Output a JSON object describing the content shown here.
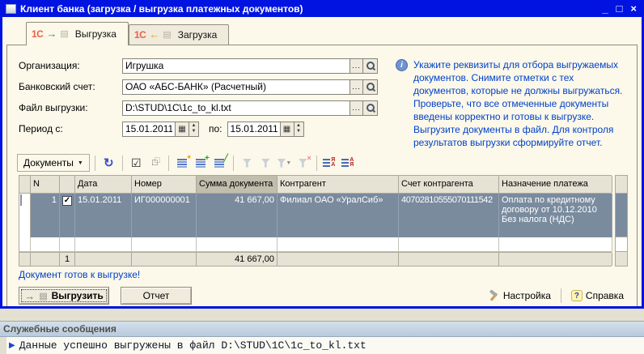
{
  "window": {
    "title": "Клиент банка (загрузка / выгрузка платежных документов)",
    "minimize_glyph": "_",
    "maximize_glyph": "□",
    "close_glyph": "×"
  },
  "tabs": {
    "logo": "1С",
    "export": {
      "label": "Выгрузка",
      "arrow": "→"
    },
    "import": {
      "label": "Загрузка",
      "arrow": "←"
    }
  },
  "form": {
    "organization": {
      "label": "Организация:",
      "value": "Игрушка"
    },
    "bank_account": {
      "label": "Банковский счет:",
      "value": "ОАО «АБС-БАНК» (Расчетный)"
    },
    "export_file": {
      "label": "Файл выгрузки:",
      "value": "D:\\STUD\\1C\\1c_to_kl.txt"
    },
    "period": {
      "label": "Период с:",
      "from": "15.01.2011",
      "to_label": "по:",
      "to": "15.01.2011"
    }
  },
  "info_panel": {
    "icon_glyph": "i",
    "lines": [
      "Укажите реквизиты для отбора выгружаемых документов. Снимите отметки с тех документов, которые не должны выгружаться.",
      "Проверьте, что все отмеченные документы введены корректно и готовы к выгрузке.",
      "Выгрузите документы в файл. Для контроля результатов выгрузки сформируйте отчет."
    ]
  },
  "toolbar": {
    "documents_label": "Документы"
  },
  "icons": {
    "ellipsis": "...",
    "calendar": "▦",
    "spin_up": "▲",
    "spin_down": "▼",
    "dropdown_small": "▼",
    "refresh": "↻",
    "check_all": "☑",
    "uncheck_all": "□",
    "badge_star": "*",
    "badge_plus": "+",
    "badge_pencil": "╱",
    "badge_x": "×",
    "sort_desc_letters": "ЯА",
    "sort_asc_letters": "АЯ",
    "check": "✓",
    "doc": "▤"
  },
  "table": {
    "columns": {
      "icon": "",
      "n": "N",
      "check": "",
      "date": "Дата",
      "number": "Номер",
      "amount": "Сумма документа",
      "counterparty": "Контрагент",
      "account": "Счет контрагента",
      "purpose": "Назначение платежа"
    },
    "rows": [
      {
        "n": "1",
        "date": "15.01.2011",
        "number": "ИГ000000001",
        "amount": "41 667,00",
        "counterparty": "Филиал ОАО «УралСиб»",
        "account": "40702810555070111542",
        "purpose": "Оплата по кредитному договору от 10.12.2010 Без налога (НДС)"
      }
    ],
    "total": {
      "count": "1",
      "amount": "41 667,00"
    }
  },
  "status_text": "Документ готов к выгрузке!",
  "actions": {
    "export_label": "Выгрузить",
    "report_label": "Отчет",
    "settings_label": "Настройка",
    "help_label": "Справка",
    "help_glyph": "?"
  },
  "messages": {
    "title": "Служебные сообщения",
    "bullet": "▶",
    "text": "Данные успешно выгружены в файл D:\\STUD\\1C\\1c_to_kl.txt"
  },
  "colors": {
    "titlebar": "#0013e0",
    "dialog_bg": "#fcf8ea",
    "info_text": "#0042c8",
    "selected_row": "#7a8b9e",
    "selected_header": "#c2beae",
    "messages_header_bg": "#c6d5e4"
  }
}
